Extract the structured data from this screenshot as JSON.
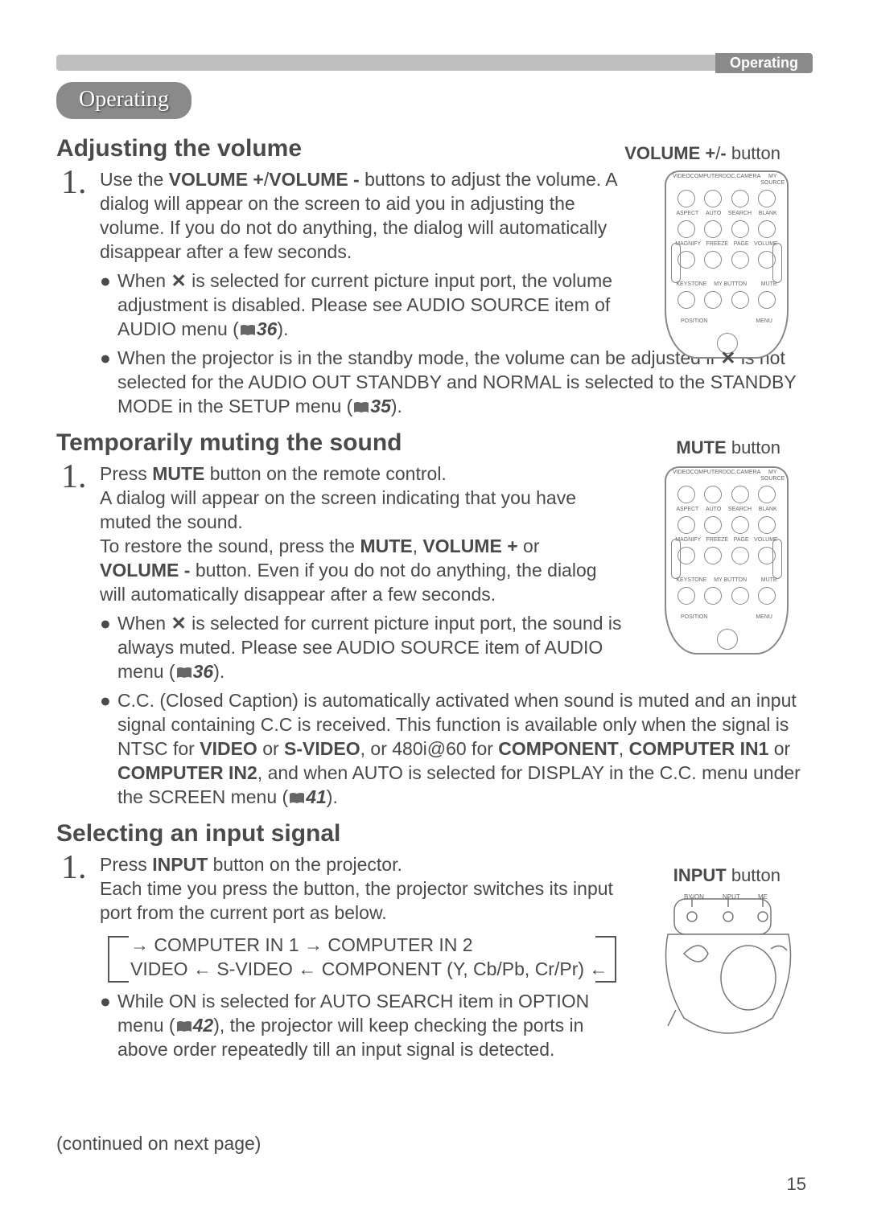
{
  "header": {
    "category": "Operating",
    "chapter": "Operating"
  },
  "sections": {
    "volume": {
      "title": "Adjusting the volume",
      "fig_label_prefix": "VOLUME +",
      "fig_label_mid": "/",
      "fig_label_suffix": "-",
      "fig_label_end": " button",
      "step1_a": "Use the ",
      "step1_b": "VOLUME +",
      "step1_c": "/",
      "step1_d": "VOLUME -",
      "step1_e": " buttons to adjust the volume. A dialog will appear on the screen to aid you in adjusting the volume. If you do not do anything, the dialog will automatically disappear after a few seconds.",
      "bullet1_a": "When ",
      "bullet1_b": " is selected for current picture input port, the volume adjustment is disabled. Please see AUDIO SOURCE item of AUDIO menu (",
      "bullet1_ref": "36",
      "bullet1_c": ").",
      "bullet2_a": "When the projector is in the standby mode, the volume can be adjusted if ",
      "bullet2_b": " is not selected for the AUDIO OUT STANDBY and NORMAL is selected to the STANDBY MODE in the SETUP menu (",
      "bullet2_ref": "35",
      "bullet2_c": ")."
    },
    "mute": {
      "title": "Temporarily muting the sound",
      "fig_label_prefix": "MUTE",
      "fig_label_end": " button",
      "step1_a": "Press ",
      "step1_b": "MUTE",
      "step1_c": " button on the remote control.",
      "step1_d": "A dialog will appear on the screen indicating that you have muted the sound.",
      "step1_e": "To restore the sound, press the  ",
      "step1_f": "MUTE",
      "step1_g": ", ",
      "step1_h": "VOLUME +",
      "step1_i": " or ",
      "step1_j": "VOLUME -",
      "step1_k": " button. Even if you do not do anything, the dialog will automatically disappear after a few seconds.",
      "bullet1_a": "When ",
      "bullet1_b": " is selected for current picture input port, the sound is always muted. Please see AUDIO SOURCE item of AUDIO menu (",
      "bullet1_ref": "36",
      "bullet1_c": ").",
      "bullet2_a": "C.C. (Closed Caption) is automatically activated when sound is muted and an input signal containing C.C is received. This function is available only when the signal is NTSC for ",
      "bullet2_b": "VIDEO",
      "bullet2_c": " or ",
      "bullet2_d": "S-VIDEO",
      "bullet2_e": ", or 480i@60 for ",
      "bullet2_f": "COMPONENT",
      "bullet2_g": ", ",
      "bullet2_h": "COMPUTER IN1",
      "bullet2_i": " or ",
      "bullet2_j": "COMPUTER IN2",
      "bullet2_k": ", and when AUTO is selected for DISPLAY in the C.C. menu under the SCREEN menu (",
      "bullet2_ref": "41",
      "bullet2_l": ")."
    },
    "input": {
      "title": "Selecting an input signal",
      "fig_label_prefix": "INPUT",
      "fig_label_end": " button",
      "step1_a": "Press ",
      "step1_b": "INPUT",
      "step1_c": " button on the projector.",
      "step1_d": "Each time you press the button, the projector switches its input port from the current port as below.",
      "cycle_line1": " COMPUTER IN 1 → COMPUTER IN 2 ",
      "cycle_line2": " VIDEO ← S-VIDEO ← COMPONENT (Y, Cb/Pb, Cr/Pr) ",
      "bullet1_a": "While ON is selected for AUTO SEARCH item in OPTION menu (",
      "bullet1_ref": "42",
      "bullet1_b": "), the projector will keep checking the ports in above order repeatedly till an input signal is detected."
    }
  },
  "remote_labels": {
    "r1": [
      "VIDEO",
      "COMPUTER",
      "DOC.CAMERA",
      "MY SOURCE"
    ],
    "r2": [
      "ASPECT",
      "AUTO",
      "SEARCH",
      "BLANK"
    ],
    "r3": [
      "MAGNIFY",
      "FREEZE",
      "PAGE",
      "VOLUME"
    ],
    "r4": [
      "KEYSTONE",
      "MY BUTTON",
      "",
      "MUTE"
    ],
    "r5": [
      "POSITION",
      "",
      "",
      "MENU"
    ]
  },
  "projector_labels": {
    "b1": "BY/ON",
    "b2": "NPUT",
    "b3": "ME"
  },
  "footer": "(continued on next page)",
  "page_number": "15"
}
